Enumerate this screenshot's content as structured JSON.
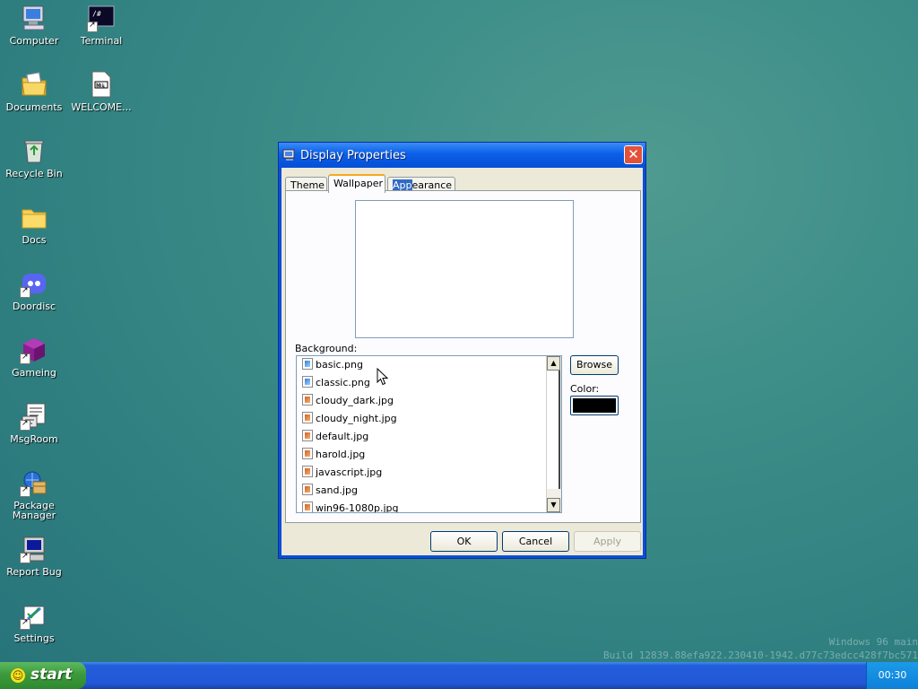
{
  "desktop": {
    "icons": [
      {
        "label": "Computer",
        "icon": "computer-icon"
      },
      {
        "label": "Terminal",
        "icon": "terminal-icon"
      },
      {
        "label": "Documents",
        "icon": "documents-icon"
      },
      {
        "label": "WELCOME...",
        "icon": "markdown-file-icon"
      },
      {
        "label": "Recycle Bin",
        "icon": "recycle-bin-icon"
      },
      {
        "label": "Docs",
        "icon": "folder-icon"
      },
      {
        "label": "Doordisc",
        "icon": "doordisc-icon"
      },
      {
        "label": "Gameing",
        "icon": "gameing-icon"
      },
      {
        "label": "MsgRoom",
        "icon": "msgroom-icon"
      },
      {
        "label": "Package Manager",
        "icon": "package-manager-icon"
      },
      {
        "label": "Report Bug",
        "icon": "report-bug-icon"
      },
      {
        "label": "Settings",
        "icon": "settings-icon"
      }
    ],
    "watermark": {
      "line1": "Windows 96 main",
      "line2": "Build 12839.88efa922.230410-1942.d77c73edcc428f7bc571"
    }
  },
  "window": {
    "title": "Display Properties",
    "close_glyph": "✕",
    "tabs": {
      "theme": "Theme",
      "wallpaper": "Wallpaper",
      "appearance_highlight": "App",
      "appearance_rest": "earance"
    },
    "background_label": "Background:",
    "files": [
      {
        "name": "basic.png",
        "type": "png"
      },
      {
        "name": "classic.png",
        "type": "png"
      },
      {
        "name": "cloudy_dark.jpg",
        "type": "jpg"
      },
      {
        "name": "cloudy_night.jpg",
        "type": "jpg"
      },
      {
        "name": "default.jpg",
        "type": "jpg"
      },
      {
        "name": "harold.jpg",
        "type": "jpg"
      },
      {
        "name": "javascript.jpg",
        "type": "jpg"
      },
      {
        "name": "sand.jpg",
        "type": "jpg"
      },
      {
        "name": "win96-1080p.jpg",
        "type": "jpg"
      }
    ],
    "browse_label": "Browse",
    "color_label": "Color:",
    "color_value": "#000000",
    "ok_label": "OK",
    "cancel_label": "Cancel",
    "apply_label": "Apply"
  },
  "taskbar": {
    "start_label": "start",
    "clock": "00:30"
  },
  "colors": {
    "titlebar": "#0b5fe6",
    "taskbar": "#245edb",
    "start": "#3c9a3c",
    "desktop": "#3c8d88"
  }
}
